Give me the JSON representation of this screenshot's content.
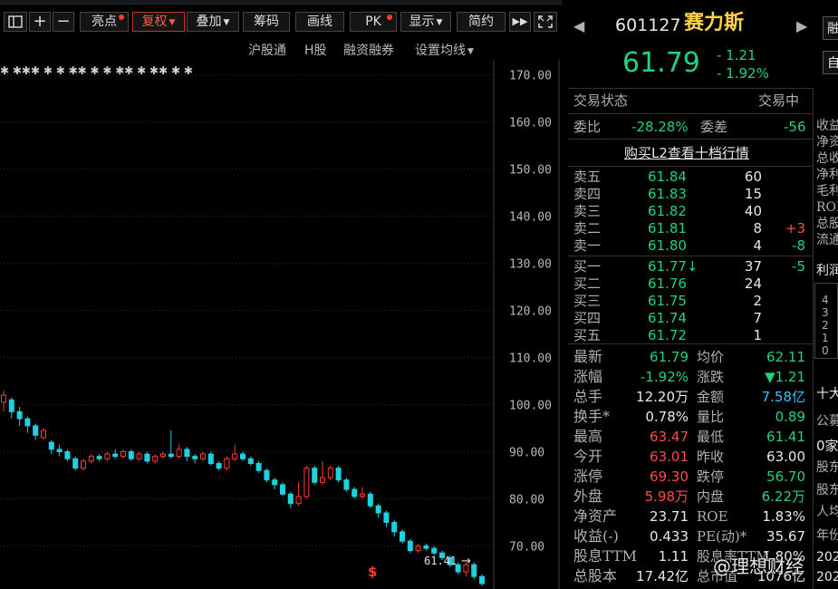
{
  "toolbar": {
    "highlight": "亮点",
    "fuquan": "复权",
    "overlay": "叠加",
    "chips": "筹码",
    "draw": "画线",
    "pk": "PK",
    "display": "显示",
    "simple": "简约"
  },
  "subbar": {
    "hgt": "沪股通",
    "hshare": "H股",
    "margin": "融资融券",
    "ma_settings": "设置均线"
  },
  "axis": {
    "ticks": [
      "170.00",
      "160.00",
      "150.00",
      "140.00",
      "130.00",
      "120.00",
      "110.00",
      "100.00",
      "90.00",
      "80.00",
      "70.00"
    ]
  },
  "chart_data": {
    "type": "candlestick",
    "y_ticks": [
      170,
      160,
      150,
      140,
      130,
      120,
      110,
      100,
      90,
      80,
      70
    ],
    "ylim": [
      60.85,
      173.2
    ],
    "last_label": "61.41",
    "candles": [
      {
        "o": 100.5,
        "c": 102.0,
        "h": 103.0,
        "l": 98.5
      },
      {
        "o": 101.0,
        "c": 98.5,
        "h": 101.5,
        "l": 97.0
      },
      {
        "o": 98.5,
        "c": 97.0,
        "h": 99.5,
        "l": 95.5
      },
      {
        "o": 97.0,
        "c": 95.5,
        "h": 97.5,
        "l": 94.0
      },
      {
        "o": 95.5,
        "c": 93.5,
        "h": 96.0,
        "l": 92.5
      },
      {
        "o": 93.0,
        "c": 94.5,
        "h": 95.0,
        "l": 92.5
      },
      {
        "o": 92.0,
        "c": 90.5,
        "h": 92.5,
        "l": 89.5
      },
      {
        "o": 90.5,
        "c": 90.0,
        "h": 91.5,
        "l": 89.0
      },
      {
        "o": 90.0,
        "c": 88.5,
        "h": 90.5,
        "l": 88.0
      },
      {
        "o": 88.5,
        "c": 86.5,
        "h": 89.0,
        "l": 86.0
      },
      {
        "o": 86.5,
        "c": 88.0,
        "h": 88.5,
        "l": 86.0
      },
      {
        "o": 88.0,
        "c": 89.0,
        "h": 89.5,
        "l": 87.5
      },
      {
        "o": 89.0,
        "c": 88.5,
        "h": 89.5,
        "l": 88.0
      },
      {
        "o": 88.5,
        "c": 89.5,
        "h": 90.0,
        "l": 88.0
      },
      {
        "o": 89.5,
        "c": 89.0,
        "h": 90.5,
        "l": 88.5
      },
      {
        "o": 89.0,
        "c": 90.0,
        "h": 90.5,
        "l": 88.5
      },
      {
        "o": 90.0,
        "c": 88.5,
        "h": 90.5,
        "l": 88.0
      },
      {
        "o": 88.5,
        "c": 89.5,
        "h": 90.0,
        "l": 88.0
      },
      {
        "o": 89.5,
        "c": 88.0,
        "h": 90.0,
        "l": 87.5
      },
      {
        "o": 88.0,
        "c": 89.0,
        "h": 89.5,
        "l": 87.5
      },
      {
        "o": 89.0,
        "c": 89.5,
        "h": 90.0,
        "l": 88.5
      },
      {
        "o": 89.5,
        "c": 89.0,
        "h": 94.5,
        "l": 88.5
      },
      {
        "o": 89.0,
        "c": 90.5,
        "h": 91.5,
        "l": 88.5
      },
      {
        "o": 90.5,
        "c": 89.0,
        "h": 91.0,
        "l": 88.0
      },
      {
        "o": 89.0,
        "c": 88.5,
        "h": 89.5,
        "l": 87.5
      },
      {
        "o": 88.5,
        "c": 89.5,
        "h": 90.0,
        "l": 88.0
      },
      {
        "o": 89.5,
        "c": 87.5,
        "h": 90.0,
        "l": 87.0
      },
      {
        "o": 87.5,
        "c": 86.5,
        "h": 88.0,
        "l": 86.0
      },
      {
        "o": 86.5,
        "c": 88.5,
        "h": 89.0,
        "l": 86.0
      },
      {
        "o": 88.5,
        "c": 89.5,
        "h": 91.5,
        "l": 88.0
      },
      {
        "o": 89.5,
        "c": 88.5,
        "h": 90.0,
        "l": 88.0
      },
      {
        "o": 88.5,
        "c": 87.5,
        "h": 89.0,
        "l": 87.0
      },
      {
        "o": 87.5,
        "c": 86.0,
        "h": 88.0,
        "l": 85.5
      },
      {
        "o": 86.0,
        "c": 84.0,
        "h": 86.5,
        "l": 83.5
      },
      {
        "o": 84.0,
        "c": 83.0,
        "h": 84.5,
        "l": 82.0
      },
      {
        "o": 83.0,
        "c": 81.0,
        "h": 83.5,
        "l": 80.5
      },
      {
        "o": 81.0,
        "c": 79.0,
        "h": 81.5,
        "l": 78.0
      },
      {
        "o": 79.0,
        "c": 80.5,
        "h": 83.5,
        "l": 78.5
      },
      {
        "o": 80.5,
        "c": 86.5,
        "h": 87.0,
        "l": 80.0
      },
      {
        "o": 86.5,
        "c": 83.5,
        "h": 87.0,
        "l": 83.0
      },
      {
        "o": 83.5,
        "c": 84.5,
        "h": 88.0,
        "l": 83.0
      },
      {
        "o": 84.5,
        "c": 86.5,
        "h": 87.0,
        "l": 84.0
      },
      {
        "o": 86.5,
        "c": 84.0,
        "h": 87.0,
        "l": 83.5
      },
      {
        "o": 84.0,
        "c": 82.0,
        "h": 84.5,
        "l": 81.5
      },
      {
        "o": 82.0,
        "c": 80.5,
        "h": 82.5,
        "l": 80.0
      },
      {
        "o": 80.5,
        "c": 81.0,
        "h": 82.5,
        "l": 80.0
      },
      {
        "o": 81.0,
        "c": 78.5,
        "h": 81.5,
        "l": 78.0
      },
      {
        "o": 78.5,
        "c": 77.0,
        "h": 79.0,
        "l": 76.0
      },
      {
        "o": 77.0,
        "c": 75.0,
        "h": 77.5,
        "l": 74.0
      },
      {
        "o": 75.0,
        "c": 73.0,
        "h": 75.5,
        "l": 72.0
      },
      {
        "o": 73.0,
        "c": 71.0,
        "h": 73.5,
        "l": 70.5
      },
      {
        "o": 71.0,
        "c": 69.0,
        "h": 71.5,
        "l": 68.5
      },
      {
        "o": 69.0,
        "c": 70.0,
        "h": 70.5,
        "l": 68.5
      },
      {
        "o": 70.0,
        "c": 69.5,
        "h": 70.5,
        "l": 69.0
      },
      {
        "o": 69.5,
        "c": 68.5,
        "h": 70.0,
        "l": 68.0
      },
      {
        "o": 68.5,
        "c": 67.5,
        "h": 69.0,
        "l": 67.0
      },
      {
        "o": 67.5,
        "c": 66.0,
        "h": 68.0,
        "l": 65.5
      },
      {
        "o": 66.0,
        "c": 64.5,
        "h": 66.5,
        "l": 64.0
      },
      {
        "o": 64.5,
        "c": 66.0,
        "h": 66.5,
        "l": 63.5
      },
      {
        "o": 66.0,
        "c": 63.5,
        "h": 66.5,
        "l": 63.0
      },
      {
        "o": 63.5,
        "c": 62.0,
        "h": 64.0,
        "l": 61.5
      }
    ],
    "star_marks": "✱  ✱✱✱  ✱  ✱  ✱✱  ✱  ✱  ✱✱  ✱  ✱✱  ✱  ✱"
  },
  "bottom": {
    "s_mark": "$",
    "last_arrow": "→",
    "watermark": "@理想财经"
  },
  "quote": {
    "code": "601127",
    "name": "赛力斯",
    "price": "61.79",
    "change": "- 1.21",
    "pct": "- 1.92%"
  },
  "status": {
    "label": "交易状态",
    "value": "交易中"
  },
  "wei": {
    "ratio_label": "委比",
    "ratio": "-28.28%",
    "diff_label": "委差",
    "diff": "-56"
  },
  "l2": "购买L2查看十档行情",
  "asks": [
    {
      "label": "卖五",
      "price": "61.84",
      "vol": "60",
      "chg": ""
    },
    {
      "label": "卖四",
      "price": "61.83",
      "vol": "15",
      "chg": ""
    },
    {
      "label": "卖三",
      "price": "61.82",
      "vol": "40",
      "chg": ""
    },
    {
      "label": "卖二",
      "price": "61.81",
      "vol": "8",
      "chg": "+3"
    },
    {
      "label": "卖一",
      "price": "61.80",
      "vol": "4",
      "chg": "-8"
    }
  ],
  "bids": [
    {
      "label": "买一",
      "price": "61.77↓",
      "vol": "37",
      "chg": "-5"
    },
    {
      "label": "买二",
      "price": "61.76",
      "vol": "24",
      "chg": ""
    },
    {
      "label": "买三",
      "price": "61.75",
      "vol": "2",
      "chg": ""
    },
    {
      "label": "买四",
      "price": "61.74",
      "vol": "7",
      "chg": ""
    },
    {
      "label": "买五",
      "price": "61.72",
      "vol": "1",
      "chg": ""
    }
  ],
  "stats": [
    {
      "l1": "最新",
      "v1": "61.79",
      "c1": "green",
      "l2": "均价",
      "v2": "62.11",
      "c2": "green"
    },
    {
      "l1": "涨幅",
      "v1": "-1.92%",
      "c1": "green",
      "l2": "涨跌",
      "v2": "▼1.21",
      "c2": "green"
    },
    {
      "l1": "总手",
      "v1": "12.20万",
      "c1": "white",
      "l2": "金额",
      "v2": "7.58亿",
      "c2": "cyan"
    },
    {
      "l1": "换手*",
      "v1": "0.78%",
      "c1": "white",
      "l2": "量比",
      "v2": "0.89",
      "c2": "green"
    },
    {
      "l1": "最高",
      "v1": "63.47",
      "c1": "red",
      "l2": "最低",
      "v2": "61.41",
      "c2": "green"
    },
    {
      "l1": "今开",
      "v1": "63.01",
      "c1": "red",
      "l2": "昨收",
      "v2": "63.00",
      "c2": "white"
    },
    {
      "l1": "涨停",
      "v1": "69.30",
      "c1": "red",
      "l2": "跌停",
      "v2": "56.70",
      "c2": "green"
    },
    {
      "l1": "外盘",
      "v1": "5.98万",
      "c1": "red",
      "l2": "内盘",
      "v2": "6.22万",
      "c2": "green"
    },
    {
      "l1": "净资产",
      "v1": "23.71",
      "c1": "white",
      "l2": "ROE",
      "v2": "1.83%",
      "c2": "white"
    },
    {
      "l1": "收益(-)",
      "v1": "0.433",
      "c1": "white",
      "l2": "PE(动)*",
      "v2": "35.67",
      "c2": "white"
    },
    {
      "l1": "股息TTM",
      "v1": "1.11",
      "c1": "white",
      "l2": "股息率TTM",
      "v2": "1.80%",
      "c2": "white"
    },
    {
      "l1": "总股本",
      "v1": "17.42亿",
      "c1": "white",
      "l2": "总市值",
      "v2": "1076亿",
      "c2": "white"
    }
  ],
  "side": {
    "btn1": "融",
    "btn2": "自",
    "labels": [
      "收益",
      "净资",
      "总收",
      "净利",
      "毛利",
      "ROE",
      "总股",
      "流通"
    ],
    "profit": "利润",
    "mini_axis": [
      "4",
      "3",
      "2",
      "1",
      "0"
    ],
    "top10": "十大",
    "company": "公募",
    "zero": "0家",
    "gu1": "股东",
    "gu2": "股东",
    "renjun": "人均",
    "year": "年份",
    "y1": "202",
    "y2": "202"
  },
  "colors": {
    "up": "#ff3b30",
    "down": "#1fd0e0",
    "bg": "#000000"
  }
}
